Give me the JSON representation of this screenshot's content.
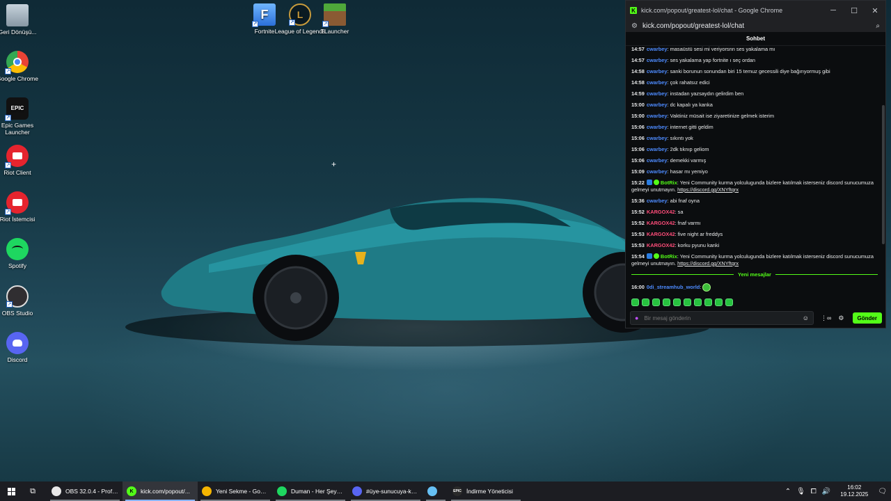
{
  "desktop_icons": [
    {
      "label": "Geri Dönüşü...",
      "icon": "recycle-bin-icon"
    },
    {
      "label": "Google Chrome",
      "icon": "chrome-icon"
    },
    {
      "label": "Epic Games Launcher",
      "icon": "epic-games-icon",
      "glyph": "EPIC"
    },
    {
      "label": "Riot Client",
      "icon": "riot-client-icon"
    },
    {
      "label": "Riot İstemcisi",
      "icon": "riot-client-icon"
    },
    {
      "label": "Spotify",
      "icon": "spotify-icon"
    },
    {
      "label": "OBS Studio",
      "icon": "obs-icon"
    },
    {
      "label": "Discord",
      "icon": "discord-icon"
    },
    {
      "label": "Fortnite",
      "icon": "fortnite-icon",
      "glyph": "F"
    },
    {
      "label": "League of Legends",
      "icon": "league-icon",
      "glyph": "L"
    },
    {
      "label": "TLauncher",
      "icon": "minecraft-icon"
    }
  ],
  "chat_window": {
    "title": "kick.com/popout/greatest-lol/chat - Google Chrome",
    "favicon": "K",
    "url": "kick.com/popout/greatest-lol/chat",
    "header": "Sohbet",
    "new_messages_label": "Yeni mesajlar",
    "input_placeholder": "Bir mesaj gönderin",
    "send_label": "Gönder",
    "accent": "#53fc18"
  },
  "messages": [
    {
      "time": "14:57",
      "user": "cwarbey",
      "color": "#4d8bff",
      "text": ": masaüstü sesi mi veriyorsnn ses yakalama mı"
    },
    {
      "time": "14:57",
      "user": "cwarbey",
      "color": "#4d8bff",
      "text": ": ses yakalama yap fortnite ı seç ordan"
    },
    {
      "time": "14:58",
      "user": "cwarbey",
      "color": "#4d8bff",
      "text": ": sanki borunun sonundan biri 15 temuz gecessili diye bağırıyormuş gibi"
    },
    {
      "time": "14:58",
      "user": "cwarbey",
      "color": "#4d8bff",
      "text": ": çok rahatsız edici"
    },
    {
      "time": "14:59",
      "user": "cwarbey",
      "color": "#4d8bff",
      "text": ": instadan yazsaydın gelirdim ben"
    },
    {
      "time": "15:00",
      "user": "cwarbey",
      "color": "#4d8bff",
      "text": ": dc kapalı ya kanka"
    },
    {
      "time": "15:00",
      "user": "cwarbey",
      "color": "#4d8bff",
      "text": ": Vaktiniz müsait ise ziyaretinize gelmek isterim"
    },
    {
      "time": "15:06",
      "user": "cwarbey",
      "color": "#4d8bff",
      "text": ": internet gitti geldim"
    },
    {
      "time": "15:06",
      "user": "cwarbey",
      "color": "#4d8bff",
      "text": ": sıkıntı yok"
    },
    {
      "time": "15:06",
      "user": "cwarbey",
      "color": "#4d8bff",
      "text": ": 2dk tıknıp geliom"
    },
    {
      "time": "15:06",
      "user": "cwarbey",
      "color": "#4d8bff",
      "text": ": demekki varmış"
    },
    {
      "time": "15:09",
      "user": "cwarbey",
      "color": "#4d8bff",
      "text": ": hasar mı yemiyo"
    },
    {
      "time": "15:22",
      "user": "BotRix",
      "color": "#53fc18",
      "bot": true,
      "text": ": Yeni Community kurma yolculugunda bizlere katılmak isterseniz discord sunucumuza gelmeyi unutmayın. ",
      "link": "https://discord.gg/XNYftqrx"
    },
    {
      "time": "15:36",
      "user": "cwarbey",
      "color": "#4d8bff",
      "text": ": abi fnaf oyna"
    },
    {
      "time": "15:52",
      "user": "KARGOX42",
      "color": "#ff4d7a",
      "text": ": sa"
    },
    {
      "time": "15:52",
      "user": "KARGOX42",
      "color": "#ff4d7a",
      "text": ": fnaf varmı"
    },
    {
      "time": "15:53",
      "user": "KARGOX42",
      "color": "#ff4d7a",
      "text": ": five night ar freddys"
    },
    {
      "time": "15:53",
      "user": "KARGOX42",
      "color": "#ff4d7a",
      "text": ": korku pyunu kanki"
    },
    {
      "time": "15:54",
      "user": "BotRix",
      "color": "#53fc18",
      "bot": true,
      "text": ": Yeni Community kurma yolculugunda bizlere katılmak isterseniz discord sunucumuza gelmeyi unutmayın. ",
      "link": "https://discord.gg/XNYftqrx"
    }
  ],
  "new_message": {
    "time": "16:00",
    "user": "0di_streamhub_world",
    "color": "#4d8bff",
    "text": ":"
  },
  "taskbar": {
    "items": [
      {
        "label": "OBS 32.0.4 - Profil: l...",
        "icon": "obs-icon",
        "color": "#e8e8e8"
      },
      {
        "label": "kick.com/popout/...",
        "icon": "kick-icon",
        "color": "#53fc18",
        "glyph": "K",
        "active": true
      },
      {
        "label": "Yeni Sekme - Googl...",
        "icon": "chrome-icon",
        "color": "#f4b400"
      },
      {
        "label": "Duman - Her Şeyi Y...",
        "icon": "spotify-icon",
        "color": "#1ed760"
      },
      {
        "label": "#üye-sunucuya-kat...",
        "icon": "discord-icon",
        "color": "#5865f2"
      },
      {
        "label": "",
        "icon": "steam-icon",
        "color": "#66c0f4"
      },
      {
        "label": "İndirme Yöneticisi",
        "icon": "epic-games-icon",
        "color": "#2a2a2a",
        "glyph": "EPIC"
      }
    ],
    "time": "16:02",
    "date": "19.12.2025"
  }
}
